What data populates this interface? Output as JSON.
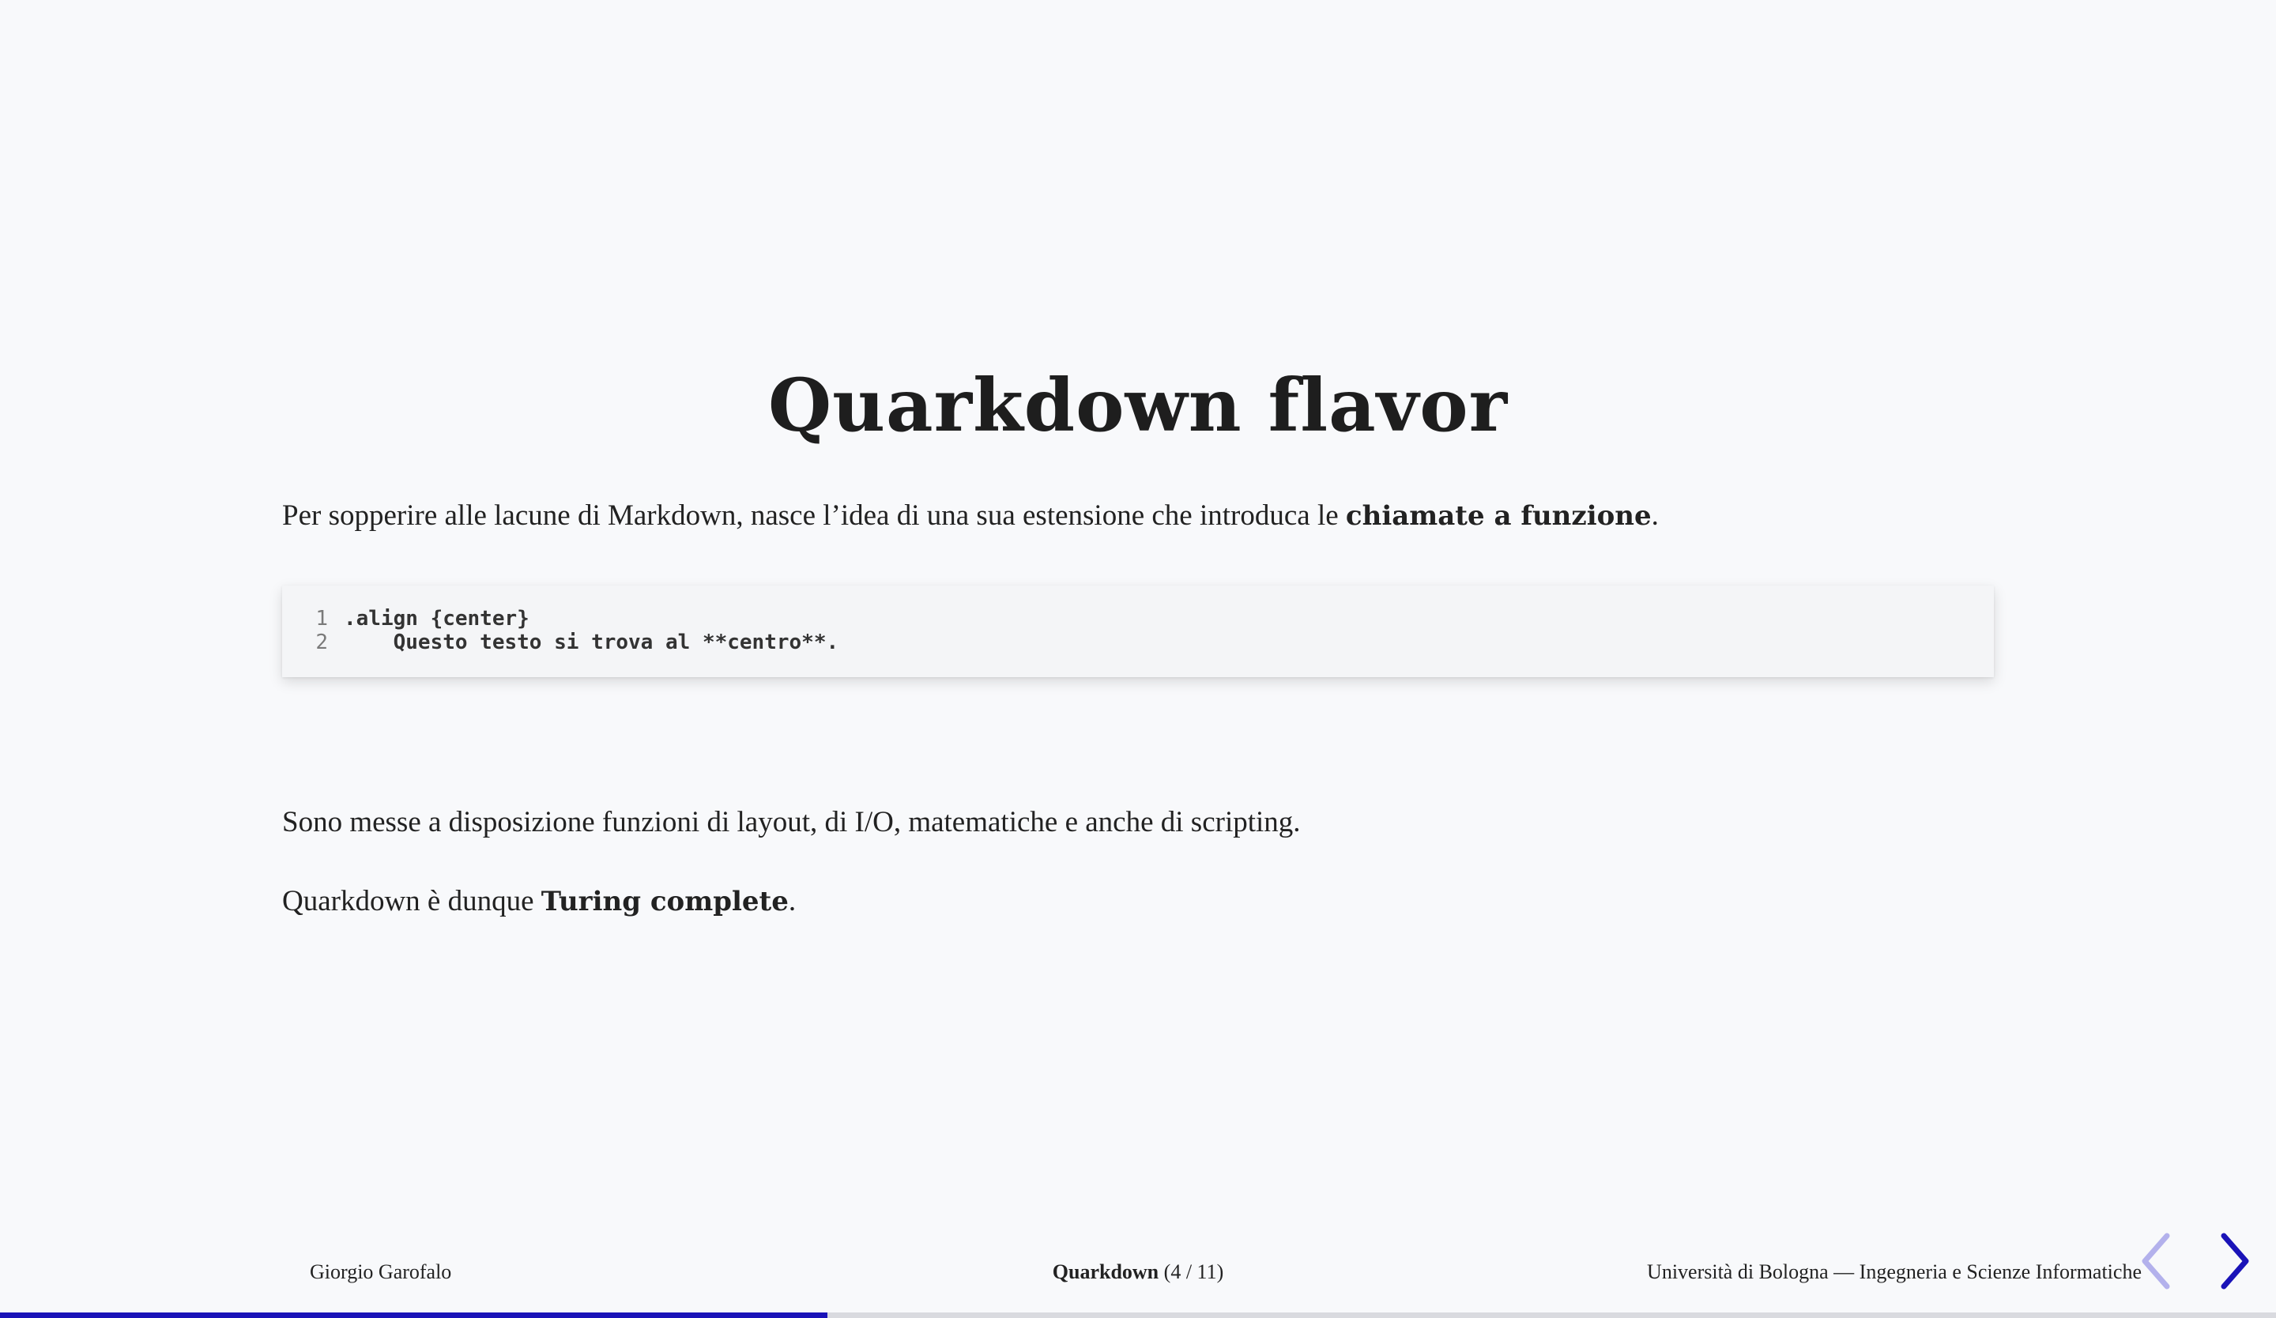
{
  "slide": {
    "title": "Quarkdown flavor",
    "intro": {
      "text_before": "Per sopperire alle lacune di Markdown, nasce l’idea di una sua estensione che introduca le ",
      "bold": "chiamate a funzione",
      "text_after": "."
    },
    "code": {
      "lines": [
        {
          "number": "1",
          "text": ".align {center}"
        },
        {
          "number": "2",
          "text": "    Questo testo si trova al **centro**."
        }
      ]
    },
    "functions_text": "Sono messe a disposizione funzioni di layout, di I/O, matematiche e anche di scripting.",
    "turing": {
      "text_before": "Quarkdown è dunque ",
      "bold": "Turing complete",
      "text_after": "."
    }
  },
  "footer": {
    "author": "Giorgio Garofalo",
    "presentation_name": "Quarkdown",
    "page_counter": "(4 / 11)",
    "institution": "Università di Bologna — Ingegneria e Scienze Informatiche"
  },
  "navigation": {
    "prev_icon": "chevron-left-icon",
    "next_icon": "chevron-right-icon",
    "prev_color": "#b3b1ec",
    "next_color": "#1a13b8"
  },
  "progress": {
    "fraction": 0.3636,
    "fill_color": "#1a13b8"
  }
}
